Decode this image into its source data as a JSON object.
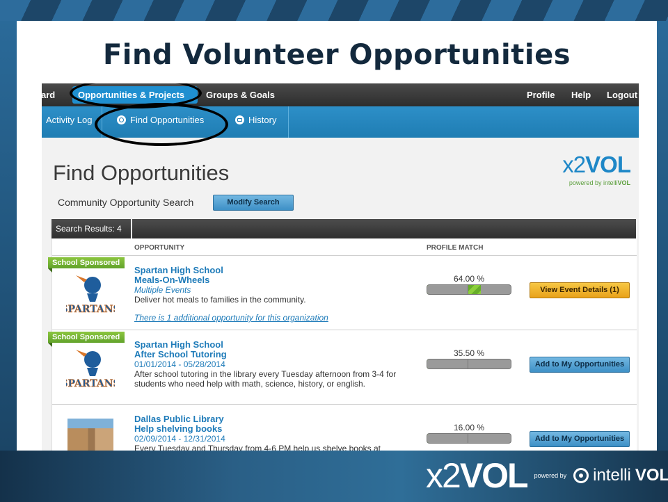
{
  "slide": {
    "title": "Find Volunteer Opportunities"
  },
  "topnav": {
    "items": [
      "ard",
      "Opportunities & Projects",
      "Groups & Goals",
      "Profile",
      "Help",
      "Logout"
    ],
    "active": "Opportunities & Projects"
  },
  "subnav": {
    "items": [
      "Activity Log",
      "Find Opportunities",
      "History"
    ],
    "active": "Find Opportunities"
  },
  "page": {
    "heading": "Find Opportunities",
    "search_label": "Community Opportunity Search",
    "modify_button": "Modify Search",
    "results_label": "Search Results: 4",
    "brand": {
      "x2": "x2",
      "vol": "VOL",
      "powered_by": "powered by",
      "intelli": "intelli",
      "intelli_vol": "VOL"
    }
  },
  "table": {
    "columns": [
      "OPPORTUNITY",
      "PROFILE MATCH"
    ],
    "rows": [
      {
        "ribbon": "School Sponsored",
        "org": "Spartan High School",
        "name": "Meals-On-Wheels",
        "subtitle": "Multiple Events",
        "description": "Deliver hot meals to families in the community.",
        "link": "There is 1 additional opportunity for this organization",
        "match_pct": 64.0,
        "match_text": "64.00 %",
        "button": "View Event Details (1)",
        "button_style": "orange"
      },
      {
        "ribbon": "School Sponsored",
        "org": "Spartan High School",
        "name": "After School Tutoring",
        "subtitle": "01/01/2014 - 05/28/2014",
        "description": "After school tutoring in the library every Tuesday afternoon from 3-4 for students who need help with math, science, history, or english.",
        "link": "",
        "match_pct": 35.5,
        "match_text": "35.50 %",
        "button": "Add to My Opportunities",
        "button_style": "blue"
      },
      {
        "ribbon": "",
        "org": "Dallas Public Library",
        "name": "Help shelving books",
        "subtitle": "02/09/2014 - 12/31/2014",
        "description": "Every Tuesday and Thursday from 4-6 PM help us shelve books at",
        "link": "",
        "match_pct": 16.0,
        "match_text": "16.00 %",
        "button": "Add to My Opportunities",
        "button_style": "blue"
      }
    ]
  },
  "footer": {
    "x2": "x2",
    "vol": "VOL",
    "powered_by": "powered by",
    "intelli": "intelli",
    "intelli_vol": "VOL"
  },
  "colors": {
    "accent_blue": "#1e87c7",
    "nav_dark": "#2d2d2d",
    "ribbon_green": "#62a32b",
    "button_orange": "#e9a21a",
    "title_navy": "#13293d"
  }
}
